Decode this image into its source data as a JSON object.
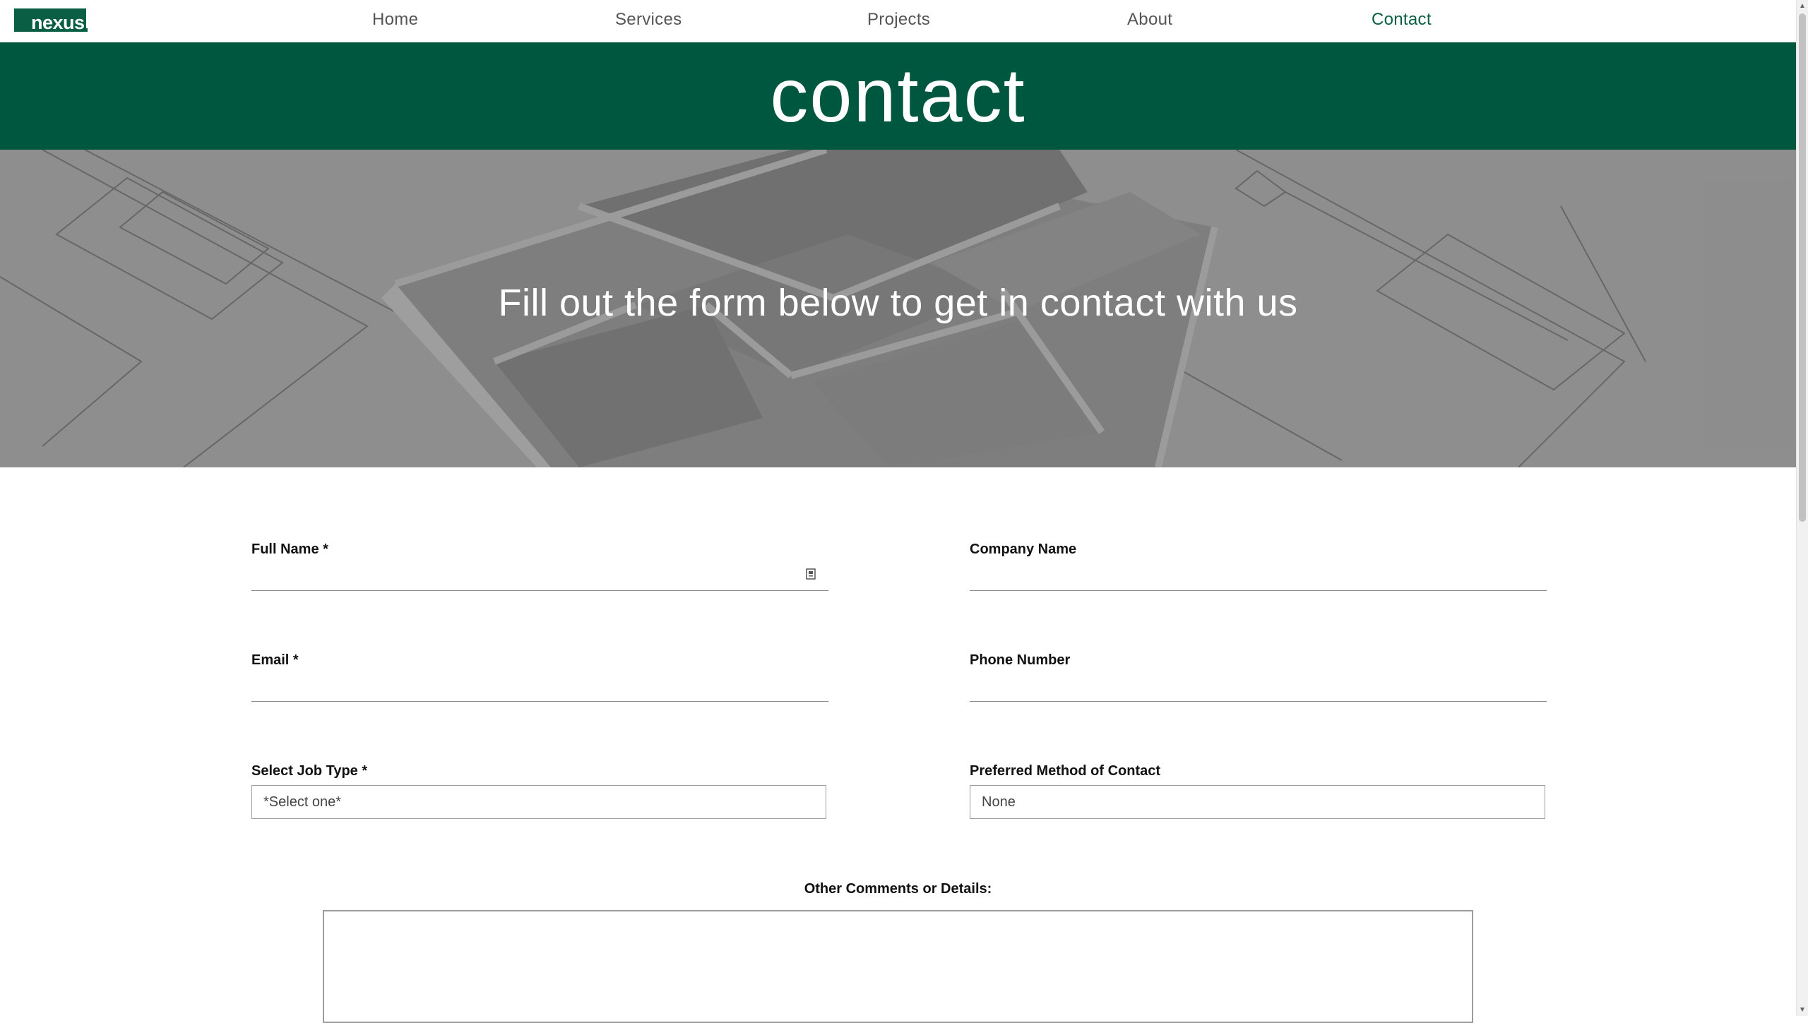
{
  "brand": {
    "logo_text": "nexus."
  },
  "nav": {
    "home": "Home",
    "services": "Services",
    "projects": "Projects",
    "about": "About",
    "contact": "Contact",
    "active": "Contact"
  },
  "page": {
    "title": "contact",
    "hero_text": "Fill out the form below to get in contact with us"
  },
  "form": {
    "full_name_label": "Full Name *",
    "full_name_value": "",
    "company_label": "Company Name",
    "company_value": "",
    "email_label": "Email *",
    "email_value": "",
    "phone_label": "Phone Number",
    "phone_value": "",
    "job_type_label": "Select Job Type *",
    "job_type_selected": "*Select one*",
    "contact_method_label": "Preferred Method of Contact",
    "contact_method_selected": "None",
    "comments_label": "Other Comments or Details:",
    "comments_value": ""
  },
  "colors": {
    "brand_green": "#00573f",
    "active_nav": "#0a5e44",
    "nav_text": "#555555"
  }
}
